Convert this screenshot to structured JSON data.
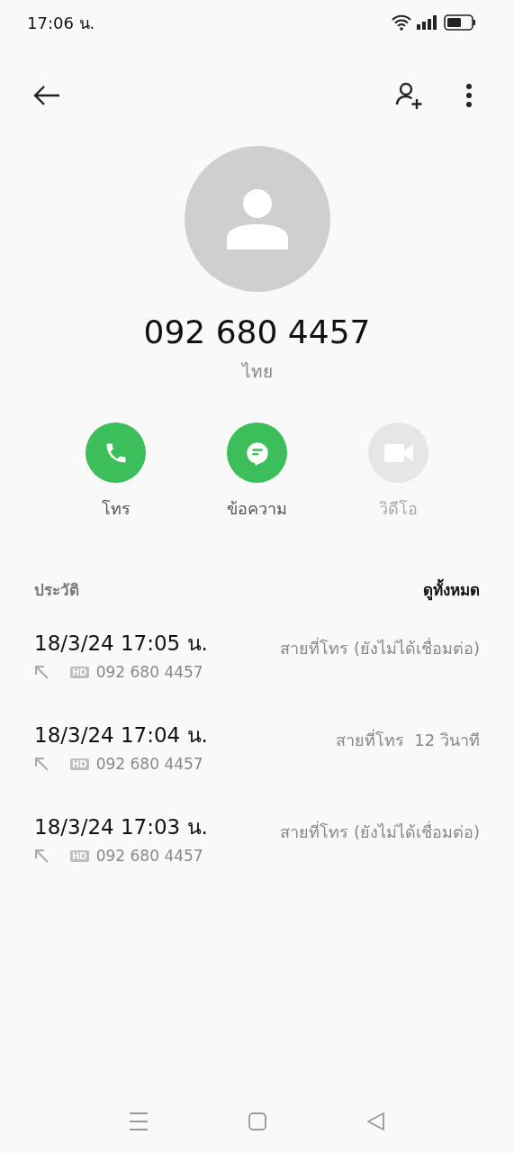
{
  "status_bar": {
    "time": "17:06 น."
  },
  "contact": {
    "number": "092 680 4457",
    "location": "ไทย"
  },
  "actions": [
    {
      "kind": "call",
      "label": "โทร",
      "disabled": false
    },
    {
      "kind": "message",
      "label": "ข้อความ",
      "disabled": false
    },
    {
      "kind": "video",
      "label": "วิดีโอ",
      "disabled": true
    }
  ],
  "history": {
    "title": "ประวัติ",
    "see_all": "ดูทั้งหมด",
    "rows": [
      {
        "datetime": "18/3/24 17:05 น.",
        "badge": "HD",
        "number": "092 680 4457",
        "status": "สายที่โทร (ยังไม่ได้เชื่อมต่อ)"
      },
      {
        "datetime": "18/3/24 17:04 น.",
        "badge": "HD",
        "number": "092 680 4457",
        "status": "สายที่โทร  12 วินาที"
      },
      {
        "datetime": "18/3/24 17:03 น.",
        "badge": "HD",
        "number": "092 680 4457",
        "status": "สายที่โทร (ยังไม่ได้เชื่อมต่อ)"
      }
    ]
  }
}
